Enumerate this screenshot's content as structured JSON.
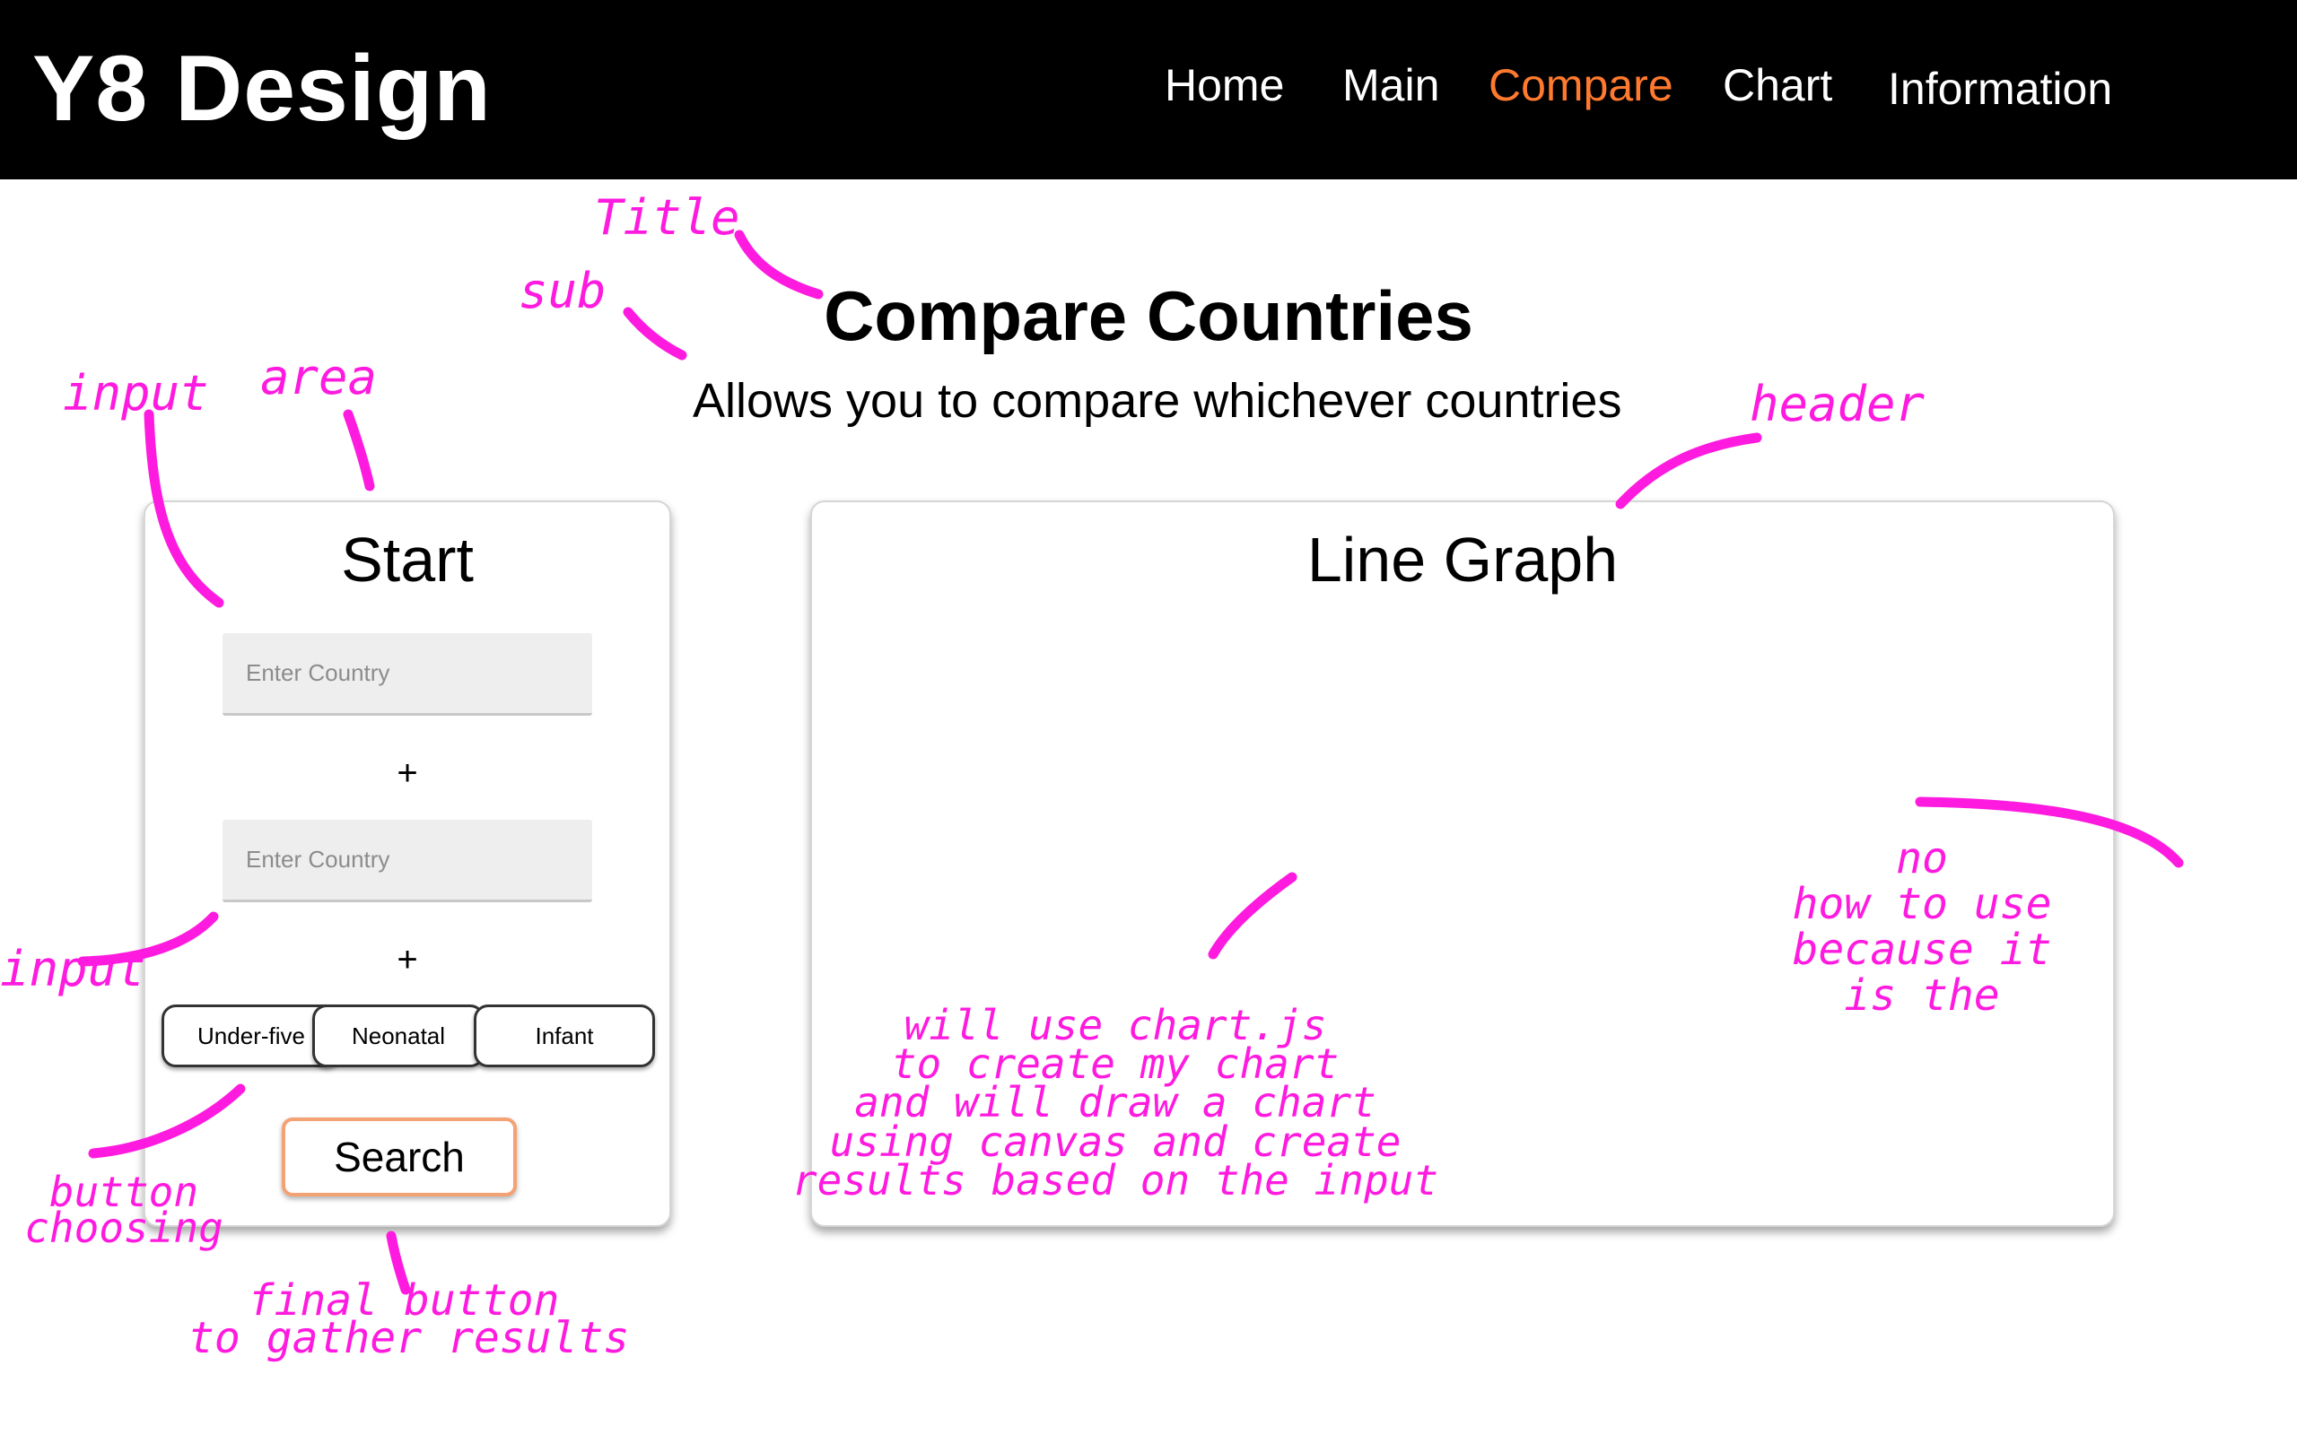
{
  "header": {
    "brand": "Y8 Design",
    "nav": [
      "Home",
      "Main",
      "Compare",
      "Chart",
      "Information"
    ],
    "active_nav": "Compare",
    "accent_color": "#ff7a2e"
  },
  "page": {
    "title": "Compare Countries",
    "subtitle": "Allows you to compare whichever countries"
  },
  "start_panel": {
    "title": "Start",
    "input_placeholder_1": "Enter Country",
    "input_placeholder_2": "Enter Country",
    "plus_1": "+",
    "plus_2": "+",
    "filters": [
      "Under-five",
      "Neonatal",
      "Infant"
    ],
    "search_label": "Search"
  },
  "graph_panel": {
    "title": "Line Graph"
  },
  "annotations": {
    "color": "#ff1adf",
    "title": "Title",
    "sub": "sub",
    "input_1": "input",
    "area": "area",
    "header": "header",
    "input_2": "input",
    "button_choosing": [
      "button",
      "choosing"
    ],
    "final_button": [
      "final button",
      "to gather results"
    ],
    "chart_note": [
      "will use chart.js",
      "to create my chart",
      "and will draw a chart",
      "using canvas and create",
      "results based on the input"
    ],
    "how_to_use": [
      "no",
      "how to use",
      "because it",
      "is the"
    ]
  }
}
